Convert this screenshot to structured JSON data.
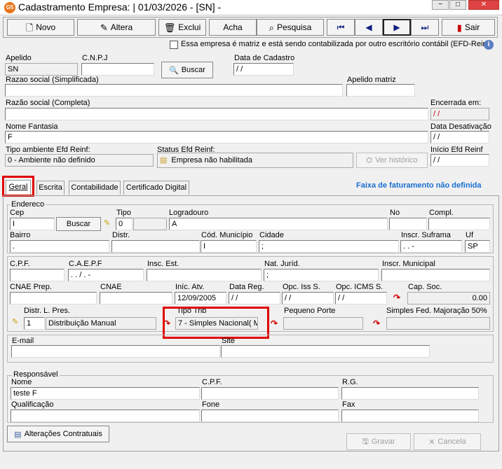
{
  "window": {
    "app_badge": "G5",
    "title": "Cadastramento Empresa: |  01/03/2026 - [SN] -",
    "btn_minimize": "−",
    "btn_maximize": "□",
    "btn_close": "✕"
  },
  "toolbar": {
    "novo": "Novo",
    "altera": "Altera",
    "exclui": "Exclui",
    "acha": "Acha",
    "pesquisa": "Pesquisa",
    "first": "⏮",
    "prev": "◀",
    "next": "▶",
    "last": "⏭",
    "sair": "Sair"
  },
  "header": {
    "matriz_check_label": "Essa empresa é matriz e está sendo contabilizada por outro escritório contábil (EFD-Reinf",
    "info_icon": "i"
  },
  "empresa": {
    "apelido_label": "Apelido",
    "apelido_value": "SN",
    "cnpj_label": "C.N.P.J",
    "cnpj_value": "",
    "buscar_label": "Buscar",
    "data_cadastro_label": "Data de Cadastro",
    "data_cadastro_value": " / /",
    "razao_simpl_label": "Razao social (Simplificada)",
    "razao_simpl_value": "",
    "apelido_matriz_label": "Apelido matriz",
    "apelido_matriz_value": "",
    "razao_completa_label": "Razão social (Completa)",
    "razao_completa_value": "",
    "encerrada_label": "Encerrada em:",
    "encerrada_value": " / /",
    "nome_fantasia_label": "Nome Fantasia",
    "nome_fantasia_value": "F",
    "data_desativacao_label": "Data Desativação",
    "data_desativacao_value": " / /",
    "tipo_ambiente_label": "Tipo ambiente Efd Reinf:",
    "tipo_ambiente_value": "0 - Ambiente não definido",
    "status_efd_label": "Status Efd Reinf:",
    "status_efd_value": "Empresa não habilitada",
    "ver_historico_label": "Ver histórico",
    "inicio_efd_label": "Início Efd Reinf",
    "inicio_efd_value": " / /"
  },
  "tabs": {
    "geral": "Geral",
    "escrita": "Escrita",
    "contabilidade": "Contabilidade",
    "certificado": "Certificado Digital",
    "faixa_warning": "Faixa de faturamento não definida"
  },
  "endereco": {
    "legend": "Endereco",
    "cep_label": "Cep",
    "cep_value": "I",
    "buscar_label": "Buscar",
    "tipo_label": "Tipo",
    "tipo_value": "0",
    "logradouro_label": "Logradouro",
    "logradouro_value": "A",
    "no_label": "No",
    "no_value": "",
    "compl_label": "Compl.",
    "compl_value": "",
    "bairro_label": "Bairro",
    "bairro_value": ".",
    "distr_label": "Distr.",
    "distr_value": "",
    "cod_municipio_label": "Cód. Município",
    "cod_municipio_value": "I",
    "cidade_label": "Cidade",
    "cidade_value": ";",
    "inscr_suframa_label": "Inscr. Suframa",
    "inscr_suframa_value": ".   .   -",
    "uf_label": "Uf",
    "uf_value": "SP"
  },
  "fiscal": {
    "cpf_label": "C.P.F.",
    "cpf_value": "",
    "caepf_label": "C.A.E.P.F",
    "caepf_value": ".   .   /   .   -",
    "insc_est_label": "Insc. Est.",
    "insc_est_value": "",
    "nat_jurid_label": "Nat. Juríd.",
    "nat_jurid_value": ";",
    "insc_municipal_label": "Inscr. Municipal",
    "insc_municipal_value": "",
    "cnae_prep_label": "CNAE Prep.",
    "cnae_prep_value": "",
    "cnae_label": "CNAE",
    "cnae_value": "",
    "inic_atv_label": "Iníc. Atv.",
    "inic_atv_value": "12/09/2005",
    "data_reg_label": "Data Reg.",
    "data_reg_value": " / /",
    "opc_iss_label": "Opc. Iss S.",
    "opc_iss_value": " / /",
    "opc_icms_label": "Opc. ICMS S.",
    "opc_icms_value": " / /",
    "cap_soc_label": "Cap. Soc.",
    "cap_soc_value": "0.00",
    "distr_l_pres_label": "Distr. L. Pres.",
    "distr_l_pres_code": "1",
    "distr_l_pres_value": "Distribuição Manual",
    "tipo_trib_label": "Tipo Trib",
    "tipo_trib_value": "7 - Simples Nacional( M",
    "pequeno_porte_label": "Pequeno Porte",
    "pequeno_porte_value": "",
    "simples_maj_label": "Simples Fed. Majoração 50%",
    "simples_maj_value": ""
  },
  "contato": {
    "email_label": "E-mail",
    "email_value": "",
    "site_label": "Site",
    "site_value": ""
  },
  "responsavel": {
    "legend": "Responsável",
    "nome_label": "Nome",
    "nome_value": "teste F",
    "cpf_label": "C.P.F.",
    "cpf_value": "",
    "rg_label": "R.G.",
    "rg_value": "",
    "qualificacao_label": "Qualificação",
    "qualificacao_value": "",
    "fone_label": "Fone",
    "fone_value": "",
    "fax_label": "Fax",
    "fax_value": ""
  },
  "footer": {
    "alteracoes_label": "Alterações Contratuais",
    "gravar_label": "Gravar",
    "cancelar_label": "Cancela"
  },
  "colors": {
    "highlight": "#e00000",
    "warning_text": "#1a6fd0",
    "date_placeholder": "#c00000"
  }
}
